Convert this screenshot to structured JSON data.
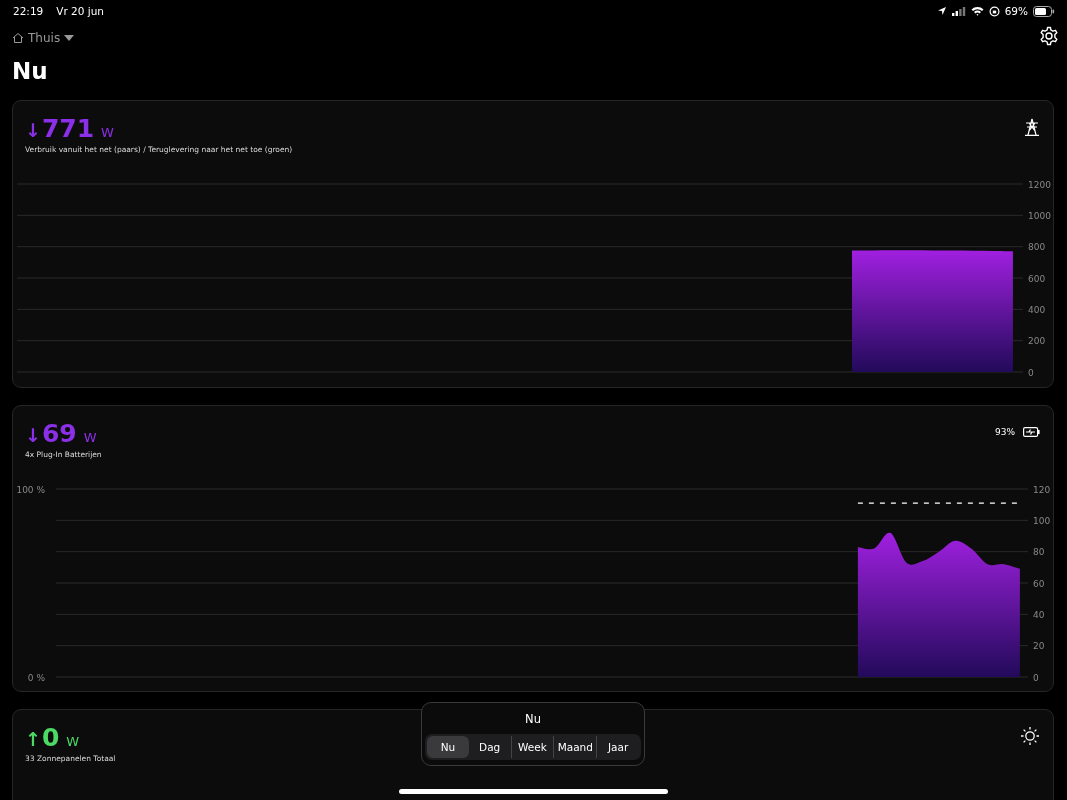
{
  "status_bar": {
    "time": "22:19",
    "date": "Vr 20 jun",
    "battery_percent": "69%"
  },
  "header": {
    "location": "Thuis",
    "title": "Nu"
  },
  "cards": [
    {
      "kind": "grid",
      "arrow": "↓",
      "value": "771",
      "unit": "W",
      "color": "#8b2fe8",
      "caption": "Verbruik vanuit het net (paars) / Teruglevering naar het net toe (groen)",
      "chart_data": {
        "type": "area",
        "grid": true,
        "ylim": [
          0,
          1200
        ],
        "yticks": [
          0,
          200,
          400,
          600,
          800,
          1000,
          1200
        ],
        "series": [
          {
            "color": "#a020e0",
            "values": [
              null,
              null,
              null,
              null,
              null,
              null,
              null,
              null,
              null,
              null,
              null,
              null,
              null,
              null,
              null,
              null,
              null,
              null,
              null,
              null,
              null,
              null,
              null,
              null,
              null,
              null,
              null,
              null,
              null,
              null,
              null,
              null,
              null,
              null,
              null,
              null,
              null,
              null,
              null,
              null,
              null,
              775,
              776,
              777,
              777,
              776,
              775,
              774,
              773,
              771
            ]
          }
        ]
      }
    },
    {
      "kind": "battery",
      "arrow": "↓",
      "value": "69",
      "unit": "W",
      "color": "#8b2fe8",
      "caption": "4x Plug-In Batterijen",
      "charge": "93%",
      "left_axis_labels": [
        "100 %",
        "0 %"
      ],
      "chart_data": {
        "type": "area",
        "grid": true,
        "ylim": [
          0,
          120
        ],
        "yticks": [
          0,
          20,
          40,
          60,
          80,
          100,
          120
        ],
        "series": [
          {
            "color": "#a020e0",
            "values": [
              null,
              null,
              null,
              null,
              null,
              null,
              null,
              null,
              null,
              null,
              null,
              null,
              null,
              null,
              null,
              null,
              null,
              null,
              null,
              null,
              null,
              null,
              null,
              null,
              null,
              null,
              null,
              null,
              null,
              null,
              null,
              null,
              null,
              null,
              null,
              null,
              null,
              null,
              null,
              null,
              null,
              null,
              null,
              null,
              null,
              null,
              null,
              null,
              null,
              83,
              82,
              92,
              73,
              74,
              80,
              87,
              82,
              72,
              72,
              69
            ]
          },
          {
            "type": "line",
            "line_style": "dashed",
            "color": "#ffffff",
            "values": [
              null,
              null,
              null,
              null,
              null,
              null,
              null,
              null,
              null,
              null,
              null,
              null,
              null,
              null,
              null,
              null,
              null,
              null,
              null,
              null,
              null,
              null,
              null,
              null,
              null,
              null,
              null,
              null,
              null,
              null,
              null,
              null,
              null,
              null,
              null,
              null,
              null,
              null,
              null,
              null,
              null,
              null,
              null,
              null,
              null,
              null,
              null,
              null,
              null,
              111,
              111,
              111,
              111,
              111,
              111,
              111,
              111,
              111,
              111,
              111
            ]
          }
        ]
      }
    },
    {
      "kind": "solar",
      "arrow": "↑",
      "value": "0",
      "unit": "W",
      "color": "#4cd964",
      "caption": "33 Zonnepanelen Totaal"
    }
  ],
  "period_picker": {
    "title": "Nu",
    "segments": [
      {
        "label": "Nu",
        "selected": true
      },
      {
        "label": "Dag",
        "selected": false
      },
      {
        "label": "Week",
        "selected": false
      },
      {
        "label": "Maand",
        "selected": false
      },
      {
        "label": "Jaar",
        "selected": false
      }
    ]
  }
}
